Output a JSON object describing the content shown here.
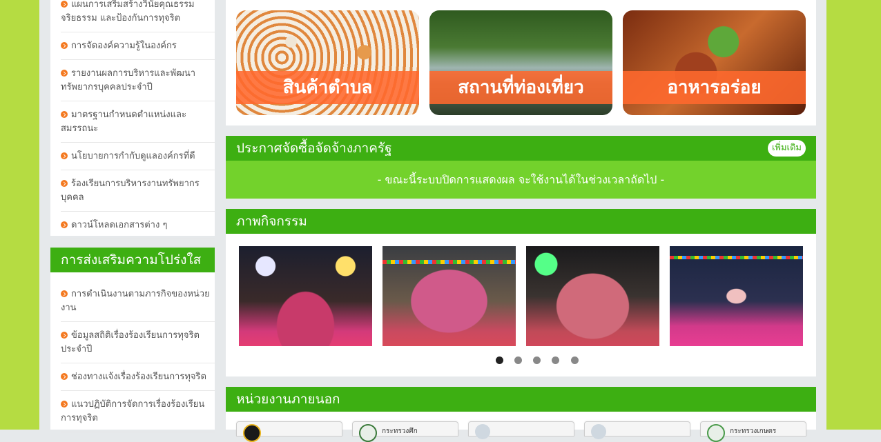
{
  "sidebar": {
    "top_items": [
      "แผนการเสริมสร้างวินัยคุณธรรม จริยธรรม และป้องกันการทุจริต",
      "การจัดองค์ความรู้ในองค์กร",
      "รายงานผลการบริหารและพัฒนาทรัพยากรบุคคลประจำปี",
      "มาตรฐานกำหนดตำแหน่งและสมรรถนะ",
      "นโยบายการกำกับดูแลองค์กรที่ดี",
      "ร้องเรียนการบริหารงานทรัพยากรบุคคล",
      "ดาวน์โหลดเอกสารต่าง ๆ"
    ],
    "transparency": {
      "title": "การส่งเสริมความโปร่งใส",
      "items": [
        "การดำเนินงานตามภารกิจของหน่วยงาน",
        "ข้อมูลสถิติเรื่องร้องเรียนการทุจริตประจำปี",
        "ช่องทางแจ้งเรื่องร้องเรียนการทุจริต",
        "แนวปฏิบัติการจัดการเรื่องร้องเรียนการทุจริต"
      ]
    }
  },
  "banners": [
    "สินค้าตำบล",
    "สถานที่ท่องเที่ยว",
    "อาหารอร่อย"
  ],
  "procurement": {
    "title": "ประกาศจัดซื้อจัดจ้างภาครัฐ",
    "more_label": "เพิ่มเติม",
    "message": "- ขณะนี้ระบบปิดการแสดงผล จะใช้งานได้ในช่วงเวลาถัดไป -"
  },
  "gallery": {
    "title": "ภาพกิจกรรม",
    "slide_count": 5,
    "active_slide": 1
  },
  "external": {
    "title": "หน่วยงานภายนอก",
    "items": [
      "",
      "กระทรวงศึก",
      "",
      "",
      "กระทรวงเกษตร"
    ]
  },
  "colors": {
    "primary_green": "#3daf12",
    "light_green": "#73d22c",
    "edge_green": "#b5dc42",
    "bullet_orange": "#f47920"
  }
}
